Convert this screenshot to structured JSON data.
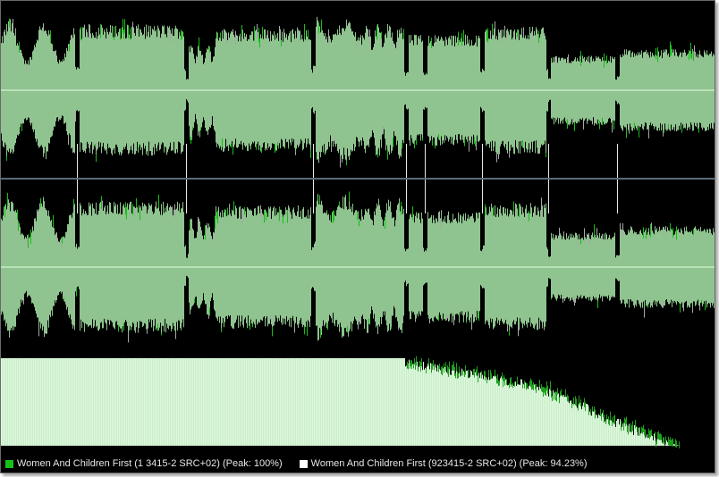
{
  "colors": {
    "background": "#000000",
    "waveform_fill": "#8fc38f",
    "waveform_peak_track_a": "#16c016",
    "waveform_peak_track_b": "#a8a8a8",
    "center_line": "#c8ecc8",
    "channel_divider": "#5a6b7a",
    "histogram_fill": "#dff7df",
    "histogram_edge": "#1ea01e"
  },
  "legend": [
    {
      "label": "Women And Children First (1 3415-2 SRC+02) (Peak: 100%)",
      "color": "#16c016"
    },
    {
      "label": "Women And Children First (923415-2 SRC+02) (Peak: 94.23%)",
      "color": "#ffffff"
    }
  ],
  "chart_data": {
    "type": "area",
    "channels": [
      "upper",
      "lower"
    ],
    "track_markers": [
      85,
      207,
      349,
      453,
      474,
      538,
      612,
      689
    ],
    "peaks": [
      {
        "track": "Women And Children First (1 3415-2 SRC+02)",
        "peak_percent": 100
      },
      {
        "track": "Women And Children First (923415-2 SRC+02)",
        "peak_percent": 94.23
      }
    ]
  }
}
